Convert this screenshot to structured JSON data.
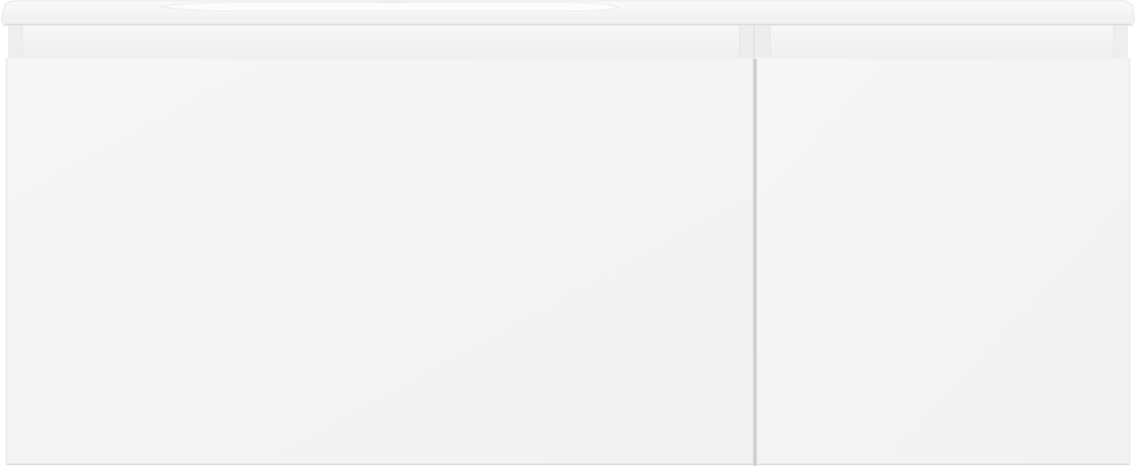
{
  "image": {
    "subject": "white-wall-hung-bathroom-vanity",
    "colors": {
      "background": "#ffffff",
      "countertop": "#f7f7f7",
      "countertop_edge": "#e4e4e4",
      "basin": "#fcfcfc",
      "recess": "#f2f2f2",
      "recess_shadow": "#e6e6e6",
      "panel": "#f4f4f4",
      "panel_edge": "#dedede",
      "gap": "#c9c9c9"
    }
  }
}
